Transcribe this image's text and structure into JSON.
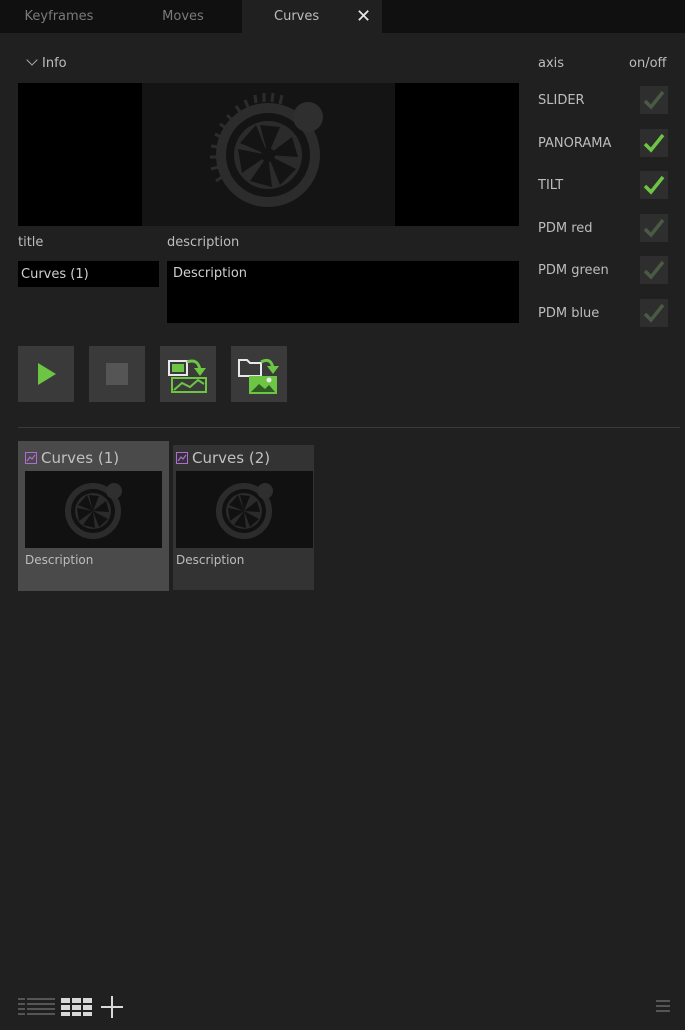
{
  "tabs": [
    {
      "label": "Keyframes"
    },
    {
      "label": "Moves"
    },
    {
      "label": "Curves"
    }
  ],
  "tab_close_label": "✕",
  "info": {
    "toggle_label": "Info"
  },
  "fields": {
    "title_label": "title",
    "title_value": "Curves (1)",
    "description_label": "description",
    "description_value": "Description"
  },
  "axis_panel": {
    "axis_header": "axis",
    "onoff_header": "on/off",
    "rows": [
      {
        "name": "SLIDER",
        "enabled": true,
        "active": false
      },
      {
        "name": "PANORAMA",
        "enabled": true,
        "active": true
      },
      {
        "name": "TILT",
        "enabled": true,
        "active": true
      },
      {
        "name": "PDM red",
        "enabled": true,
        "active": false
      },
      {
        "name": "PDM green",
        "enabled": true,
        "active": false
      },
      {
        "name": "PDM blue",
        "enabled": true,
        "active": false
      }
    ]
  },
  "colors": {
    "accent_green": "#6cc644",
    "dim_green": "#4a5a44",
    "curve_icon_purple": "#b06bd8"
  },
  "toolbar": {
    "icons": [
      "play-icon",
      "stop-icon",
      "import-curve-icon",
      "open-image-icon"
    ]
  },
  "cards": [
    {
      "title": "Curves (1)",
      "description": "Description",
      "selected": true
    },
    {
      "title": "Curves (2)",
      "description": "Description",
      "selected": false
    }
  ],
  "bottom_bar": {
    "icons": [
      "list-view-icon",
      "grid-view-icon",
      "add-icon",
      "menu-icon"
    ]
  }
}
